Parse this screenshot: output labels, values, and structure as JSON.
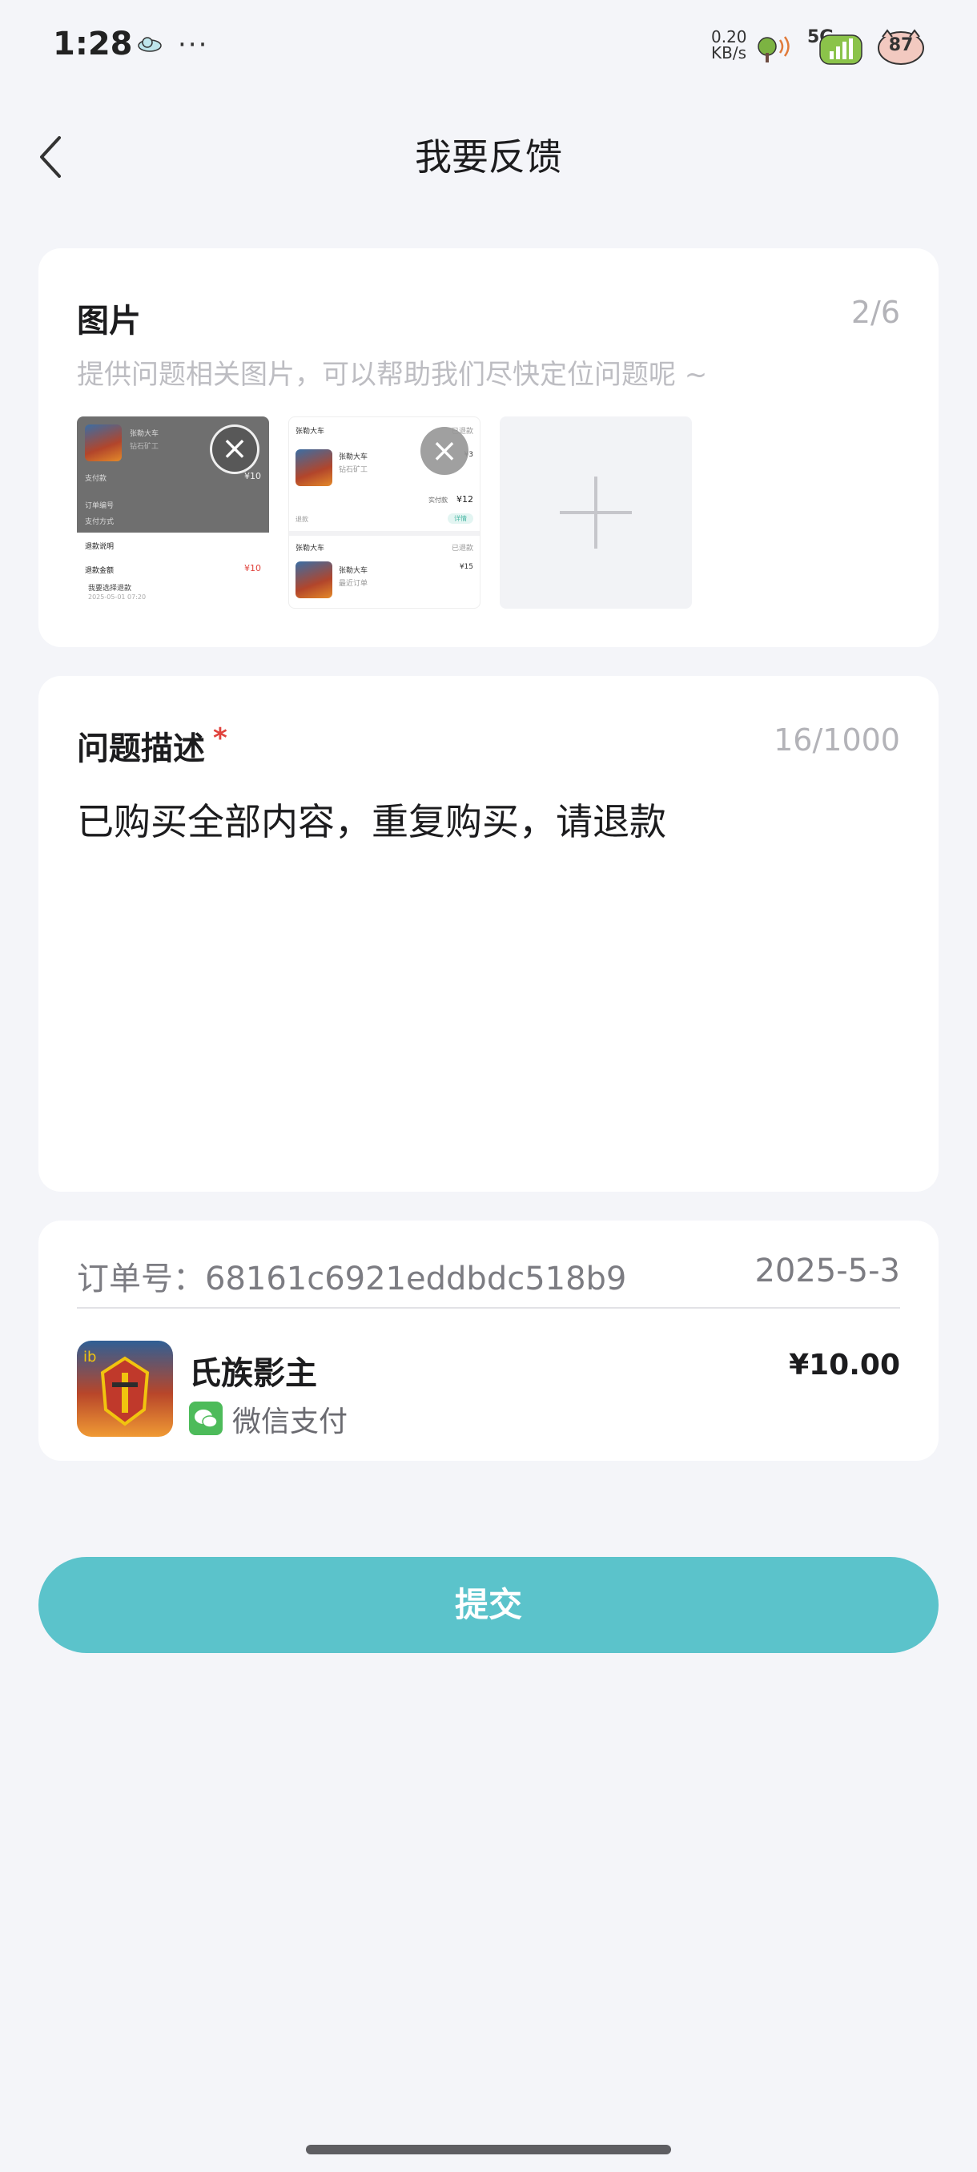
{
  "status_bar": {
    "time": "1:28",
    "dots": "···",
    "net_speed_value": "0.20",
    "net_speed_unit": "KB/s",
    "signal": "5G",
    "battery": "87"
  },
  "header": {
    "title": "我要反馈"
  },
  "images_section": {
    "title": "图片",
    "counter": "2/6",
    "hint": "提供问题相关图片，可以帮助我们尽快定位问题呢 ~",
    "remove_label": "×",
    "thumb1": {
      "name": "张勒大车",
      "sub": "钻石矿工",
      "pay_label": "支付款",
      "pay_value": "¥10",
      "order_label": "订单编号",
      "way_label": "支付方式",
      "popup_title": "退款说明",
      "popup_amount_label": "退款金额",
      "popup_amount": "¥10",
      "popup_option": "我要选择退款",
      "popup_date": "2025-05-01 07:20"
    },
    "thumb2": {
      "header": "张勒大车",
      "status": "已退款",
      "name": "张勒大车",
      "sub": "钻石矿工",
      "price": "¥3",
      "total_label": "实付款",
      "total": "¥12",
      "action": "详情",
      "footer": "退款",
      "header2": "张勒大车",
      "status2": "已退款",
      "name2": "张勒大车",
      "sub2": "最近订单",
      "price2": "¥15"
    }
  },
  "description_section": {
    "title": "问题描述",
    "required_mark": "*",
    "counter": "16/1000",
    "text": "已购买全部内容，重复购买，请退款"
  },
  "order": {
    "number_label": "订单号：68161c6921eddbdc518b9",
    "date": "2025-5-3",
    "product_name": "氏族影主",
    "pay_method": "微信支付",
    "price": "¥10.00"
  },
  "submit": {
    "label": "提交"
  },
  "colors": {
    "accent": "#5bc3cb",
    "required": "#e0433d",
    "wechat": "#4dbb5a"
  },
  "icons": [
    "back-arrow-icon",
    "plus-icon",
    "close-icon",
    "wechat-pay-icon",
    "cloud-icon",
    "battery-icon"
  ]
}
